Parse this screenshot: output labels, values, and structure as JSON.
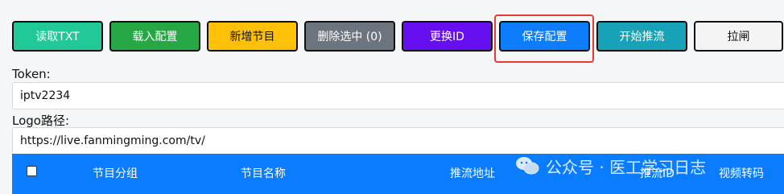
{
  "toolbar": {
    "buttons": [
      {
        "label": "读取TXT",
        "color": "#20c997"
      },
      {
        "label": "载入配置",
        "color": "#28a745"
      },
      {
        "label": "新增节目",
        "color": "#ffc107"
      },
      {
        "label": "删除选中 (0)",
        "color": "#6c757d"
      },
      {
        "label": "更换ID",
        "color": "#6610f2"
      },
      {
        "label": "保存配置",
        "color": "#0d7dfc"
      },
      {
        "label": "开始推流",
        "color": "#17a2b8"
      },
      {
        "label": "拉闸",
        "color": "#f4f4f4"
      }
    ]
  },
  "fields": {
    "token": {
      "label": "Token:",
      "value": "iptv2234"
    },
    "logo": {
      "label": "Logo路径:",
      "value": "https://live.fanmingming.com/tv/"
    }
  },
  "table": {
    "headers": [
      "节目分组",
      "节目名称",
      "推流地址",
      "推流ID",
      "视频转码"
    ]
  },
  "watermark": {
    "text": "公众号 · 医工学习日志"
  }
}
